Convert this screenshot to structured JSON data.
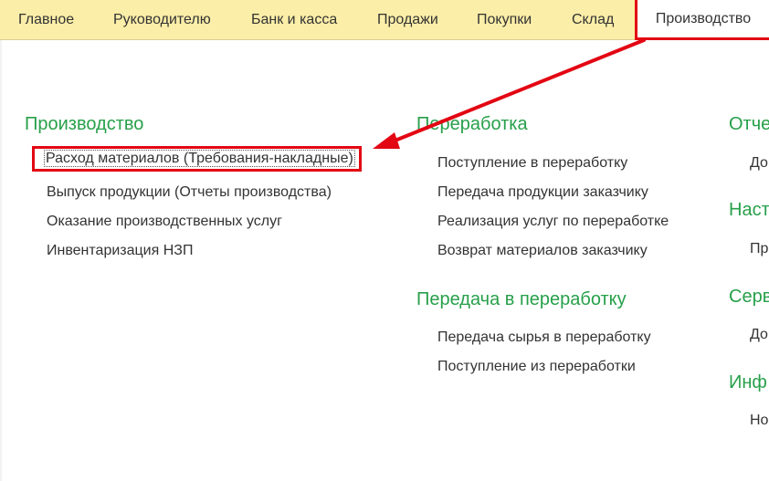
{
  "top_tabs": [
    "Главное",
    "Руководителю",
    "Банк и касса",
    "Продажи",
    "Покупки",
    "Склад",
    "Производство"
  ],
  "active_tab": "Производство",
  "columns": {
    "production": {
      "title": "Производство",
      "items": [
        "Расход материалов (Требования-накладные)",
        "Выпуск продукции (Отчеты производства)",
        "Оказание производственных услуг",
        "Инвентаризация НЗП"
      ]
    },
    "processing": {
      "title": "Переработка",
      "items": [
        "Поступление в переработку",
        "Передача продукции заказчику",
        "Реализация услуг по переработке",
        "Возврат материалов заказчику"
      ]
    },
    "transfer": {
      "title": "Передача в переработку",
      "items": [
        "Передача сырья в переработку",
        "Поступление из переработки"
      ]
    },
    "right_partial": {
      "titles": [
        "Отче",
        "Наст",
        "Серв",
        "Инф"
      ],
      "items": [
        "До",
        "Пр",
        "До",
        "Но"
      ]
    }
  },
  "colors": {
    "accent_green": "#27a04a",
    "highlight_red": "#e30613",
    "topbar_bg": "#fbeea8"
  }
}
